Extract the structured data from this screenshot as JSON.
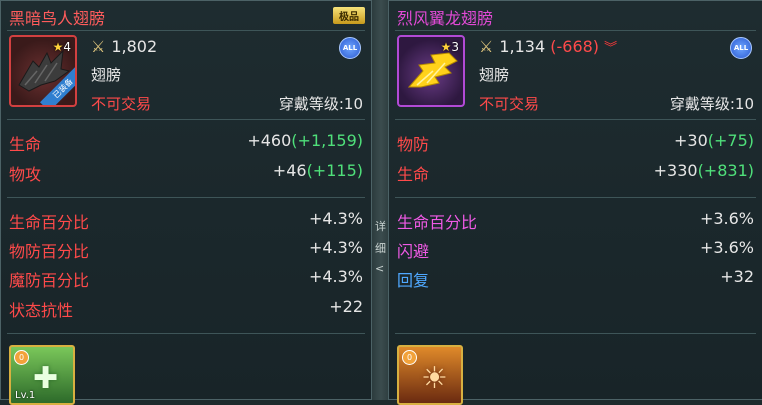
{
  "left": {
    "name": "黑暗鸟人翅膀",
    "grade": "极品",
    "level": "4",
    "equipped_tag": "已装备",
    "attack": "1,802",
    "attack_diff": "",
    "category": "翅膀",
    "trade": "不可交易",
    "requirement": "穿戴等级:10",
    "all_badge": "ALL",
    "base_stats": [
      {
        "label": "生命",
        "value": "+460",
        "bonus": "(+1,159)"
      },
      {
        "label": "物攻",
        "value": "+46",
        "bonus": "(+115)"
      }
    ],
    "extra_stats": [
      {
        "label": "生命百分比",
        "value": "+4.3%"
      },
      {
        "label": "物防百分比",
        "value": "+4.3%"
      },
      {
        "label": "魔防百分比",
        "value": "+4.3%"
      },
      {
        "label": "状态抗性",
        "value": "+22"
      }
    ],
    "card": {
      "medal": "0",
      "lv": "Lv.1"
    },
    "colors": {
      "name": "#ff5c5c",
      "frame": "#d24040"
    }
  },
  "right": {
    "name": "烈风翼龙翅膀",
    "level": "3",
    "attack": "1,134",
    "attack_diff": "(-668)",
    "attack_diff_icon": "double-chevron-down-icon",
    "category": "翅膀",
    "trade": "不可交易",
    "requirement": "穿戴等级:10",
    "all_badge": "ALL",
    "base_stats": [
      {
        "label": "物防",
        "value": "+30",
        "bonus": "(+75)"
      },
      {
        "label": "生命",
        "value": "+330",
        "bonus": "(+831)"
      }
    ],
    "extra_stats": [
      {
        "label": "生命百分比",
        "value": "+3.6%",
        "color": "pink"
      },
      {
        "label": "闪避",
        "value": "+3.6%",
        "color": "pink"
      },
      {
        "label": "回复",
        "value": "+32",
        "color": "blue"
      }
    ],
    "card": {
      "medal": "0"
    },
    "colors": {
      "name": "#e24ad6",
      "frame": "#b24ad6"
    }
  },
  "background": {
    "strip_chars": [
      "详",
      "细",
      "<"
    ]
  }
}
